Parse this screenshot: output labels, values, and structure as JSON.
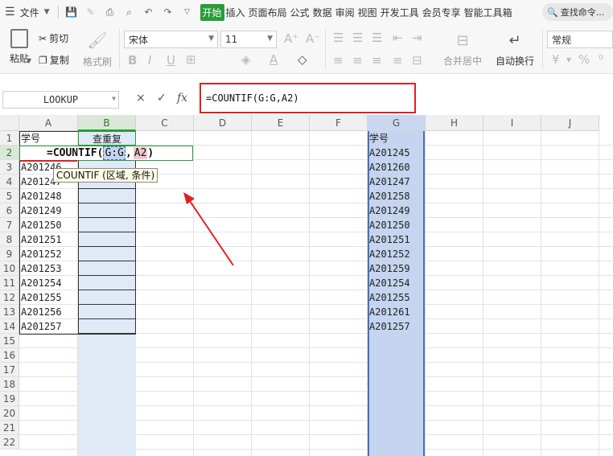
{
  "menubar": {
    "file_label": "文件",
    "tabs": [
      "开始",
      "插入",
      "页面布局",
      "公式",
      "数据",
      "审阅",
      "视图",
      "开发工具",
      "会员专享",
      "智能工具箱"
    ],
    "search_placeholder": "查找命令..."
  },
  "ribbon": {
    "paste": "粘贴",
    "cut": "剪切",
    "copy": "复制",
    "format_painter": "格式刷",
    "font_name": "宋体",
    "font_size": "11",
    "merge_center": "合并居中",
    "wrap_text": "自动换行",
    "number_format": "常规",
    "currency": "¥",
    "percent": "%"
  },
  "formula_bar": {
    "name_box": "LOOKUP",
    "cancel": "×",
    "confirm": "✓",
    "fx": "fx",
    "formula": "=COUNTIF(G:G,A2)"
  },
  "columns": [
    "A",
    "B",
    "C",
    "D",
    "E",
    "F",
    "G",
    "H",
    "I",
    "J"
  ],
  "rows": [
    "1",
    "2",
    "3",
    "4",
    "5",
    "6",
    "7",
    "8",
    "9",
    "10",
    "11",
    "12",
    "13",
    "14",
    "15",
    "16",
    "17",
    "18",
    "19",
    "20",
    "21",
    "22"
  ],
  "col_a": {
    "header": "学号",
    "values": [
      "",
      "A201246",
      "A201247",
      "A201248",
      "A201249",
      "A201250",
      "A201251",
      "A201252",
      "A201253",
      "A201254",
      "A201255",
      "A201256",
      "A201257"
    ]
  },
  "col_b": {
    "header": "查重复",
    "edit_formula_parts": [
      "=COUNTIF(",
      "G:G",
      ",",
      "A2",
      ")"
    ]
  },
  "tooltip": "COUNTIF (区域, 条件)",
  "col_g": {
    "header": "学号",
    "values": [
      "A201245",
      "A201260",
      "A201247",
      "A201258",
      "A201249",
      "A201250",
      "A201251",
      "A201252",
      "A201259",
      "A201254",
      "A201255",
      "A201261",
      "A201257"
    ]
  },
  "colors": {
    "accent": "#2a9d3a",
    "highlight_red": "#e02020",
    "range_blue": "#c5d4ef"
  }
}
